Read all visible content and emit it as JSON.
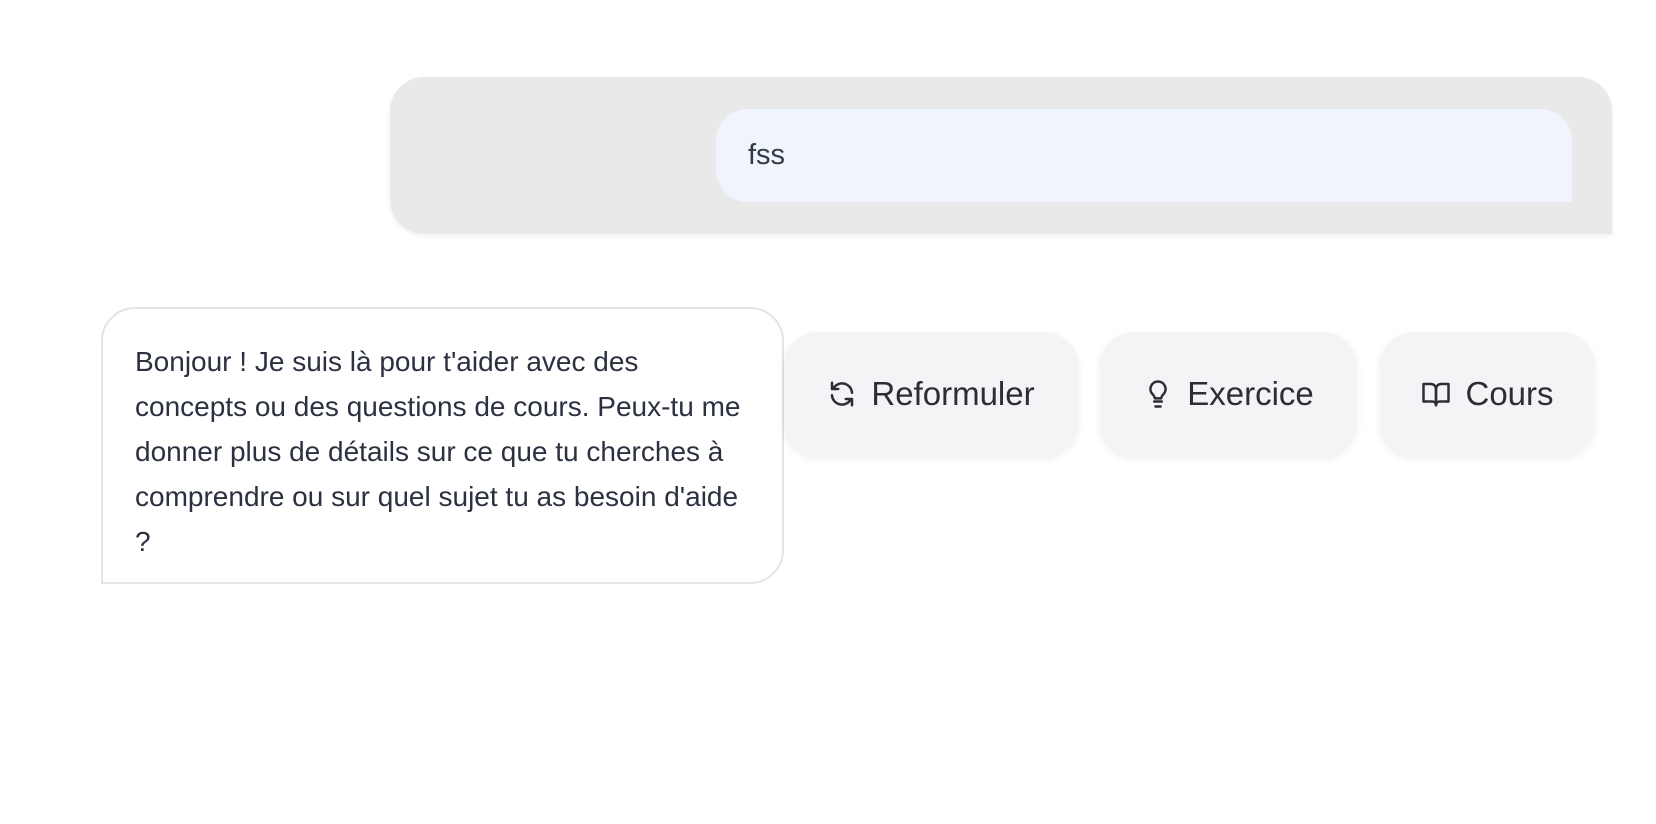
{
  "conversation": {
    "user_message": "fss",
    "assistant_message": "Bonjour ! Je suis là pour t'aider avec des concepts ou des questions de cours. Peux-tu me donner plus de détails sur ce que tu cherches à comprendre ou sur quel sujet tu as besoin d'aide ?"
  },
  "actions": [
    {
      "label": "Reformuler",
      "icon": "refresh-icon"
    },
    {
      "label": "Exercice",
      "icon": "lightbulb-icon"
    },
    {
      "label": "Cours",
      "icon": "book-open-icon"
    }
  ]
}
